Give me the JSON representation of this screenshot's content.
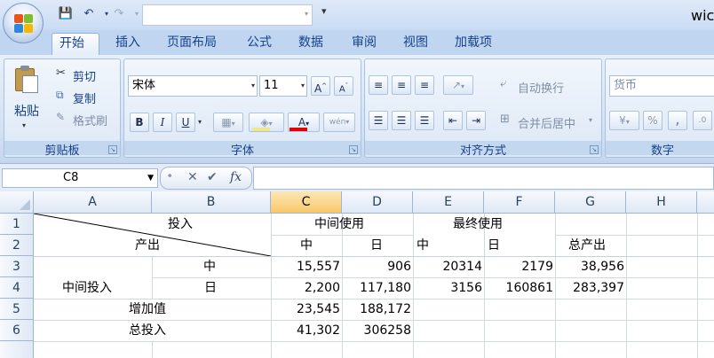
{
  "window": {
    "title": "wic"
  },
  "tabs": [
    "开始",
    "插入",
    "页面布局",
    "公式",
    "数据",
    "审阅",
    "视图",
    "加载项"
  ],
  "clipboard": {
    "paste": "粘贴",
    "cut": "剪切",
    "copy": "复制",
    "format_painter": "格式刷",
    "label": "剪贴板"
  },
  "font": {
    "name": "宋体",
    "size": "11",
    "bold": "B",
    "italic": "I",
    "underline": "U",
    "color_letter": "A",
    "label": "字体",
    "phonetic": "wén"
  },
  "alignment": {
    "wrap": "自动换行",
    "merge": "合并后居中",
    "label": "对齐方式"
  },
  "number": {
    "format": "货币",
    "percent": "%",
    "comma": ",",
    "label": "数字"
  },
  "formula_bar": {
    "cell_ref": "C8",
    "fx": "fx"
  },
  "columns": [
    "A",
    "B",
    "C",
    "D",
    "E",
    "F",
    "G",
    "H"
  ],
  "rows": [
    "1",
    "2",
    "3",
    "4",
    "5",
    "6"
  ],
  "cells": {
    "b1": "投入",
    "b2": "产出",
    "cd1": "中间使用",
    "ef1": "最终使用",
    "c2": "中",
    "d2": "日",
    "e2": "中",
    "f2": "日",
    "g2": "总产出",
    "b3": "中",
    "c3": "15,557",
    "d3": "906",
    "e3": "20314",
    "f3": "2179",
    "g3": "38,956",
    "a4": "中间投入",
    "b4": "日",
    "c4": "2,200",
    "d4": "117,180",
    "e4": "3156",
    "f4": "160861",
    "g4": "283,397",
    "ab5": "增加值",
    "c5": "23,545",
    "d5": "188,172",
    "ab6": "总投入",
    "c6": "41,302",
    "d6": "306258"
  },
  "colors": {
    "accent": "#15428b",
    "selected_header": "#f8c86b",
    "font_color_bar": "#e00000"
  }
}
